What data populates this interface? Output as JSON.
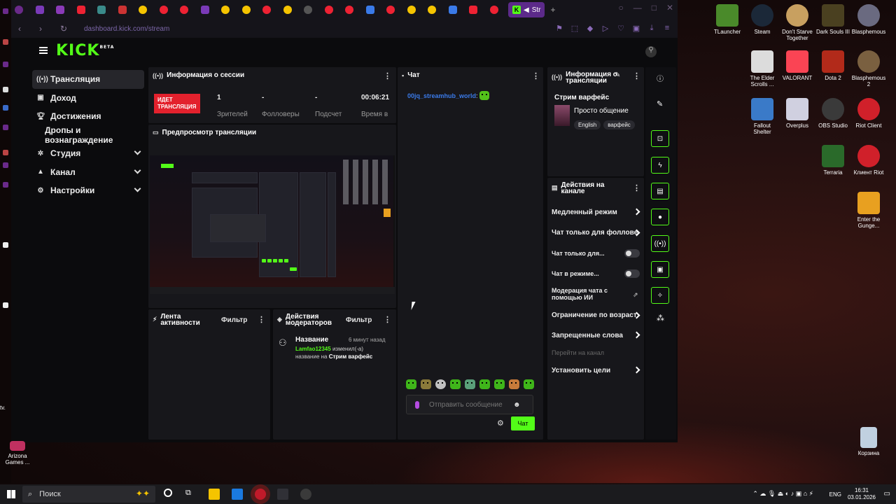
{
  "browser": {
    "active_tab": "Str",
    "url": "dashboard.kick.com/stream"
  },
  "nav": {
    "items": [
      {
        "label": "Трансляция",
        "icon": "broadcast-icon"
      },
      {
        "label": "Доход",
        "icon": "wallet-icon"
      },
      {
        "label": "Достижения",
        "icon": "trophy-icon"
      },
      {
        "label": "Дропы и вознаграждение",
        "icon": ""
      },
      {
        "label": "Студия",
        "icon": "studio-icon"
      },
      {
        "label": "Канал",
        "icon": "user-icon"
      },
      {
        "label": "Настройки",
        "icon": "gear-icon"
      }
    ]
  },
  "session": {
    "title": "Информация о сессии",
    "live_badge": "ИДЕТ ТРАНСЛЯЦИЯ",
    "viewers_value": "1",
    "viewers_label": "Зрителей",
    "followers_value": "-",
    "followers_label": "Фолловеры",
    "subs_value": "-",
    "subs_label": "Подсчет",
    "time_value": "00:06:21",
    "time_label": "Время в"
  },
  "preview": {
    "title": "Предпросмотр трансляции"
  },
  "activity": {
    "title": "Лента активности",
    "filter": "Фильтр"
  },
  "modactions": {
    "title": "Действия модераторов",
    "filter": "Фильтр",
    "entry_title": "Название",
    "entry_time": "6 минут назад",
    "entry_user": "Lamfao12345",
    "entry_text": "изменил(-а)",
    "entry_text2": "название на",
    "entry_value": "Стрим варфейс"
  },
  "chat": {
    "title": "Чат",
    "username": "00jq_streamhub_world",
    "placeholder": "Отправить сообщение",
    "send_label": "Чат"
  },
  "streaminfo": {
    "title": "Информация о трансляции",
    "stream_title": "Стрим варфейс",
    "category": "Просто общение",
    "tags": [
      "English",
      "варфейс"
    ]
  },
  "channelactions": {
    "title": "Действия на канале",
    "items": [
      {
        "label": "Медленный режим",
        "kind": "arrow"
      },
      {
        "label": "Чат только для фоллове",
        "kind": "arrow"
      },
      {
        "label": "Чат только для...",
        "kind": "toggle"
      },
      {
        "label": "Чат в режиме...",
        "kind": "toggle"
      },
      {
        "label": "Модерация чата с помощью ИИ",
        "kind": "external"
      },
      {
        "label": "Ограничение по возраст",
        "kind": "arrow"
      },
      {
        "label": "Запрещенные слова",
        "kind": "arrow"
      },
      {
        "label": "Перейти на канал",
        "kind": "disabled"
      },
      {
        "label": "Установить цели",
        "kind": "arrow"
      }
    ]
  },
  "desktop": {
    "icons": [
      {
        "label": "TLauncher",
        "color": "#4a8a2a"
      },
      {
        "label": "Steam",
        "color": "#1b2838"
      },
      {
        "label": "Don't Starve Together",
        "color": "#c8a060"
      },
      {
        "label": "Dark Souls III",
        "color": "#4a4020"
      },
      {
        "label": "Blasphemous",
        "color": "#6a6a80"
      },
      {
        "label": "The Elder Scrolls ...",
        "color": "#dcdcdc"
      },
      {
        "label": "VALORANT",
        "color": "#fa4454"
      },
      {
        "label": "Dota 2",
        "color": "#b22a1a"
      },
      {
        "label": "Blasphemous 2",
        "color": "#7a6040"
      },
      {
        "label": "Fallout Shelter",
        "color": "#3a7ac8"
      },
      {
        "label": "Overplus",
        "color": "#d0d0e0"
      },
      {
        "label": "OBS Studio",
        "color": "#3a3a3a"
      },
      {
        "label": "Riot Client",
        "color": "#d0202a"
      },
      {
        "label": "Terraria",
        "color": "#2a6a2a"
      },
      {
        "label": "Клиент Riot",
        "color": "#d0202a"
      },
      {
        "label": "Enter the Gunge...",
        "color": "#e8a020"
      },
      {
        "label": "Корзина",
        "color": "#c0d0e0"
      },
      {
        "label": "Arizona Games ...",
        "color": "#c03060"
      },
      {
        "label": "tv.",
        "color": "#000000"
      }
    ]
  },
  "taskbar": {
    "search_placeholder": "Поиск",
    "lang": "ENG",
    "time": "16:31",
    "date": "03.01.2026"
  }
}
